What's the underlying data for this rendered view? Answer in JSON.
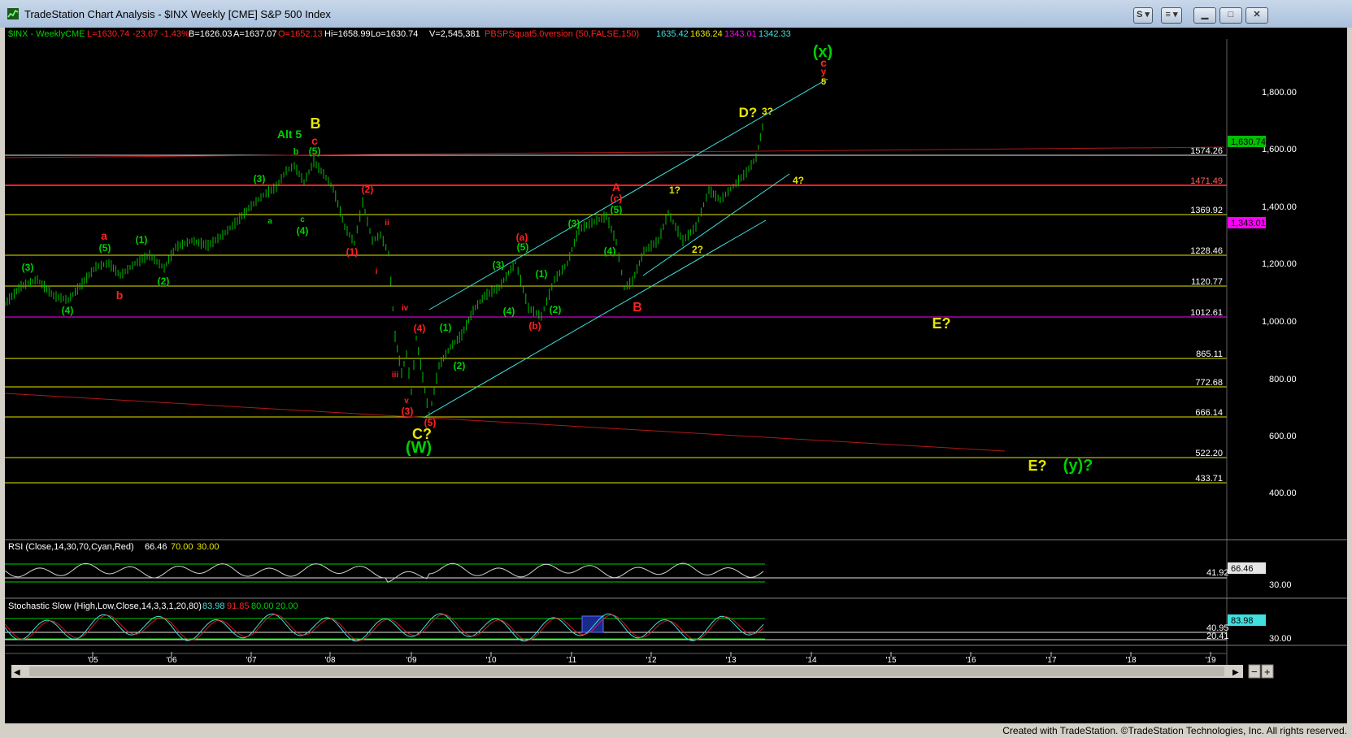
{
  "window": {
    "title": "TradeStation Chart Analysis - $INX Weekly [CME] S&P 500 Index",
    "btn_s": "S",
    "btn_menu": "≡"
  },
  "status": {
    "credit": "Created with TradeStation. ©TradeStation Technologies, Inc. All rights reserved."
  },
  "colors": {
    "background": "#000000",
    "green": "#00d000",
    "red": "#ff2020",
    "yellow": "#e6e600",
    "cyan": "#40e0e0",
    "magenta": "#ff00ff",
    "darkred": "#a01010"
  },
  "quote": {
    "symbol": "$INX - Weekly",
    "exchange": "CME",
    "last": "L=1630.74",
    "change": "-23.67",
    "pct": "-1.43%",
    "bid": "B=1626.03",
    "ask": "A=1637.07",
    "open": "O=1652.13",
    "high": "Hi=1658.99",
    "low": "Lo=1630.74",
    "volume": "V=2,545,381",
    "study": "PBSPSquat5.0version (50,FALSE,150)",
    "s1": "1635.42",
    "s2": "1636.24",
    "s3": "1343.01",
    "s4": "1342.33"
  },
  "price_axis": [
    "1,800.00",
    "1,600.00",
    "1,400.00",
    "1,200.00",
    "1,000.00",
    "800.00",
    "600.00",
    "400.00"
  ],
  "last_price_tag": "1,630.74",
  "magenta_tag": "1,343.01",
  "levels": [
    {
      "label": "1574.26",
      "color": "#e6e6e6"
    },
    {
      "label": "1471.49",
      "color": "#ff2020"
    },
    {
      "label": "1369.92",
      "color": "#e6e600"
    },
    {
      "label": "1228.46",
      "color": "#e6e600"
    },
    {
      "label": "1120.77",
      "color": "#e6e600"
    },
    {
      "label": "1012.61",
      "color": "#ff00ff"
    },
    {
      "label": "865.11",
      "color": "#e6e600"
    },
    {
      "label": "772.68",
      "color": "#e6e600"
    },
    {
      "label": "666.14",
      "color": "#e6e600"
    },
    {
      "label": "522.20",
      "color": "#e6e600"
    },
    {
      "label": "433.71",
      "color": "#e6e600"
    }
  ],
  "wave_labels": [
    {
      "t": "(x)",
      "c": "#00d000"
    },
    {
      "t": "c",
      "c": "#ff2020"
    },
    {
      "t": "y",
      "c": "#ff2020"
    },
    {
      "t": "5",
      "c": "#e6e600"
    },
    {
      "t": "D?",
      "c": "#e6e600"
    },
    {
      "t": "3?",
      "c": "#e6e600"
    },
    {
      "t": "4?",
      "c": "#e6e600"
    },
    {
      "t": "1?",
      "c": "#e6e600"
    },
    {
      "t": "2?",
      "c": "#e6e600"
    },
    {
      "t": "B",
      "c": "#e6e600"
    },
    {
      "t": "Alt 5",
      "c": "#00d000"
    },
    {
      "t": "c",
      "c": "#ff2020"
    },
    {
      "t": "b",
      "c": "#00d000"
    },
    {
      "t": "(5)",
      "c": "#00d000"
    },
    {
      "t": "(3)",
      "c": "#00d000"
    },
    {
      "t": "a",
      "c": "#00d000"
    },
    {
      "t": "c",
      "c": "#00d000"
    },
    {
      "t": "(4)",
      "c": "#00d000"
    },
    {
      "t": "(2)",
      "c": "#ff2020"
    },
    {
      "t": "(1)",
      "c": "#ff2020"
    },
    {
      "t": "ii",
      "c": "#ff2020"
    },
    {
      "t": "i",
      "c": "#ff2020"
    },
    {
      "t": "iv",
      "c": "#ff2020"
    },
    {
      "t": "iii",
      "c": "#ff2020"
    },
    {
      "t": "v",
      "c": "#ff2020"
    },
    {
      "t": "(3)",
      "c": "#ff2020"
    },
    {
      "t": "(4)",
      "c": "#ff2020"
    },
    {
      "t": "(5)",
      "c": "#ff2020"
    },
    {
      "t": "C?",
      "c": "#e6e600"
    },
    {
      "t": "(W)",
      "c": "#00d000"
    },
    {
      "t": "a",
      "c": "#ff2020"
    },
    {
      "t": "(5)",
      "c": "#00d000"
    },
    {
      "t": "b",
      "c": "#ff2020"
    },
    {
      "t": "(1)",
      "c": "#00d000"
    },
    {
      "t": "(2)",
      "c": "#00d000"
    },
    {
      "t": "(3)",
      "c": "#00d000"
    },
    {
      "t": "(4)",
      "c": "#00d000"
    },
    {
      "t": "(1)",
      "c": "#00d000"
    },
    {
      "t": "(2)",
      "c": "#00d000"
    },
    {
      "t": "(3)",
      "c": "#00d000"
    },
    {
      "t": "(4)",
      "c": "#00d000"
    },
    {
      "t": "(a)",
      "c": "#ff2020"
    },
    {
      "t": "(5)",
      "c": "#00d000"
    },
    {
      "t": "(b)",
      "c": "#ff2020"
    },
    {
      "t": "(1)",
      "c": "#00d000"
    },
    {
      "t": "(2)",
      "c": "#00d000"
    },
    {
      "t": "(3)",
      "c": "#00d000"
    },
    {
      "t": "A",
      "c": "#ff2020"
    },
    {
      "t": "(c)",
      "c": "#ff2020"
    },
    {
      "t": "(5)",
      "c": "#00d000"
    },
    {
      "t": "(4)",
      "c": "#00d000"
    },
    {
      "t": "B",
      "c": "#ff2020"
    },
    {
      "t": "E?",
      "c": "#e6e600"
    },
    {
      "t": "E?",
      "c": "#e6e600"
    },
    {
      "t": "(y)?",
      "c": "#00d000"
    }
  ],
  "x_axis": [
    "'05",
    "'06",
    "'07",
    "'08",
    "'09",
    "'10",
    "'11",
    "'12",
    "'13",
    "'14",
    "'15",
    "'16",
    "'17",
    "'18",
    "'19"
  ],
  "rsi": {
    "title": "RSI (Close,14,30,70,Cyan,Red)",
    "v1": "66.46",
    "v2": "70.00",
    "v3": "30.00",
    "tag": "66.46",
    "mid": "41.92",
    "axis30": "30.00"
  },
  "stoch": {
    "title": "Stochastic Slow (High,Low,Close,14,3,3,1,20,80)",
    "v1": "83.98",
    "v2": "91.85",
    "v3": "80.00",
    "v4": "20.00",
    "tag": "83.98",
    "l1": "40.95",
    "l2": "20.41",
    "axis30": "30.00"
  }
}
